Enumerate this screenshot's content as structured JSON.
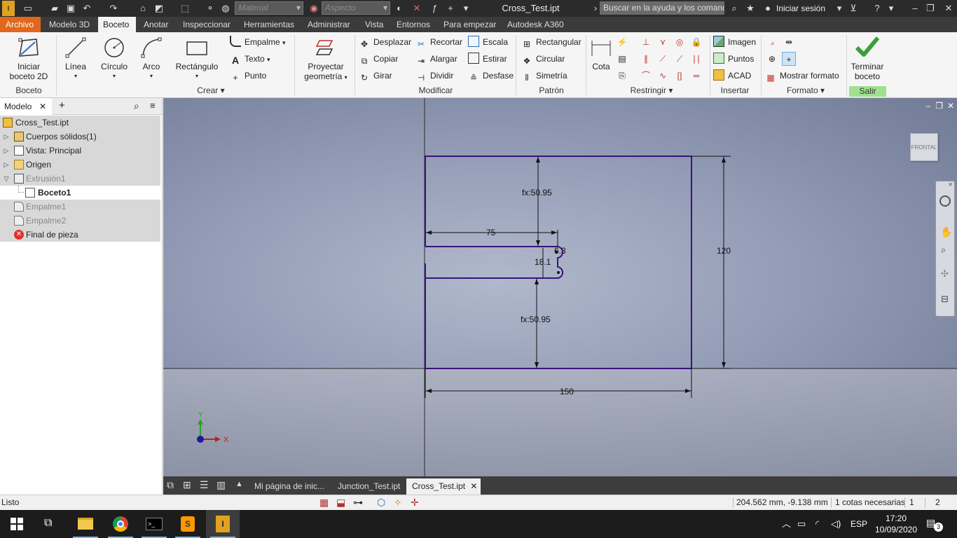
{
  "window": {
    "title": "Cross_Test.ipt",
    "material_placeholder": "Material",
    "appearance_placeholder": "Aspecto",
    "help_search_placeholder": "Buscar en la ayuda y los comandos",
    "sign_in": "Iniciar sesión"
  },
  "menu_tabs": [
    "Archivo",
    "Modelo 3D",
    "Boceto",
    "Anotar",
    "Inspeccionar",
    "Herramientas",
    "Administrar",
    "Vista",
    "Entornos",
    "Para empezar",
    "Autodesk A360"
  ],
  "active_tab": "Boceto",
  "ribbon": {
    "boceto": {
      "start_sketch_l1": "Iniciar",
      "start_sketch_l2": "boceto 2D",
      "panel": "Boceto"
    },
    "crear": {
      "linea": "Línea",
      "circulo": "Círculo",
      "arco": "Arco",
      "rectangulo": "Rectángulo",
      "empalme": "Empalme",
      "texto": "Texto",
      "punto": "Punto",
      "panel": "Crear"
    },
    "proyectar": {
      "l1": "Proyectar",
      "l2": "geometría"
    },
    "modificar": {
      "desplazar": "Desplazar",
      "copiar": "Copiar",
      "girar": "Girar",
      "recortar": "Recortar",
      "alargar": "Alargar",
      "dividir": "Dividir",
      "escala": "Escala",
      "estirar": "Estirar",
      "desfase": "Desfase",
      "panel": "Modificar"
    },
    "patron": {
      "rectangular": "Rectangular",
      "circular": "Circular",
      "simetria": "Simetría",
      "panel": "Patrón"
    },
    "restringir": {
      "cota": "Cota",
      "panel": "Restringir"
    },
    "insertar": {
      "imagen": "Imagen",
      "puntos": "Puntos",
      "acad": "ACAD",
      "panel": "Insertar"
    },
    "formato": {
      "mostrar_formato": "Mostrar formato",
      "panel": "Formato"
    },
    "salir": {
      "l1": "Terminar",
      "l2": "boceto",
      "panel": "Salir"
    }
  },
  "browser": {
    "tab": "Modelo",
    "items": [
      {
        "label": "Cross_Test.ipt"
      },
      {
        "label": "Cuerpos sólidos(1)"
      },
      {
        "label": "Vista: Principal"
      },
      {
        "label": "Origen"
      },
      {
        "label": "Extrusión1"
      },
      {
        "label": "Boceto1"
      },
      {
        "label": "Empalme1"
      },
      {
        "label": "Empalme2"
      },
      {
        "label": "Final de pieza"
      }
    ]
  },
  "sketch": {
    "dim_top": "fx:50.95",
    "dim_slot_length": "75",
    "dim_radius": "6.3",
    "dim_slot_width": "18.1",
    "dim_bottom": "fx:50.95",
    "dim_height": "120",
    "dim_width": "150",
    "view_cube_label": "FRONTAL",
    "axis_x": "X",
    "axis_y": "Y"
  },
  "doc_tabs": [
    "Mi página de inic...",
    "Junction_Test.ipt",
    "Cross_Test.ipt"
  ],
  "status": {
    "ready": "Listo",
    "coords": "204.562 mm, -9.138 mm",
    "dims_needed": "1 cotas necesarias",
    "n1": "1",
    "n2": "2"
  },
  "taskbar": {
    "lang": "ESP",
    "time": "17:20",
    "date": "10/09/2020",
    "notifications": "3"
  },
  "colors": {
    "sketch_line": "#3a137a",
    "archivo_tab": "#e0671d",
    "salir_panel": "#9fe18f"
  }
}
